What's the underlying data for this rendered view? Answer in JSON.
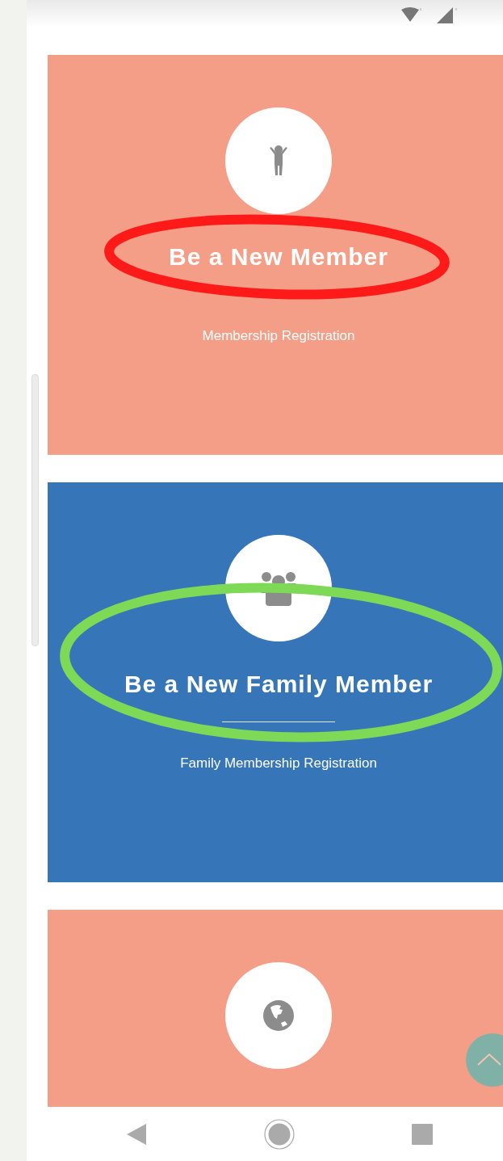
{
  "cards": [
    {
      "kind": "single",
      "title": "Be a New Member",
      "subtitle": "Membership Registration",
      "color": "#f59e87",
      "highlight": {
        "color": "#ff1a1a"
      }
    },
    {
      "kind": "family",
      "title": "Be a New Family Member",
      "subtitle": "Family Membership Registration",
      "color": "#3575b8",
      "highlight": {
        "color": "#7ed957"
      }
    },
    {
      "kind": "global",
      "color": "#f59e87"
    }
  ]
}
